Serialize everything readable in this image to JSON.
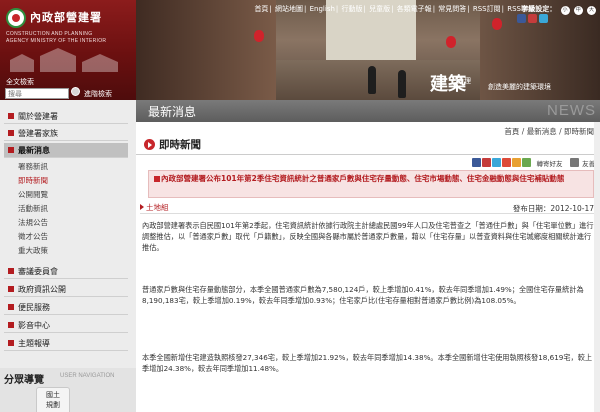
{
  "header": {
    "logo_title": "內政部營建署",
    "logo_sub1": "CONSTRUCTION AND PLANNING",
    "logo_sub2": "AGENCY MINISTRY OF THE INTERIOR",
    "search_label": "全文檢索",
    "search_placeholder": "搜尋",
    "advanced_search": "進階檢索",
    "topnav": [
      "首頁",
      "網站地圖",
      "English",
      "行動版",
      "兒童版",
      "各類電子報",
      "常見問答",
      "RSS訂閱",
      "RSS聯播"
    ],
    "font_size": {
      "label": "字級設定：",
      "small": "小",
      "medium": "中",
      "large": "大"
    },
    "brand": "建築",
    "brand_small": "管理",
    "slogan": "創造美麗的建築環境"
  },
  "title_bar": {
    "section_title": "最新消息",
    "deco": "NEWS"
  },
  "sidebar": {
    "items": [
      {
        "label": "關於營建署"
      },
      {
        "label": "營建署家族"
      },
      {
        "label": "最新消息"
      },
      {
        "label": "審議委員會"
      },
      {
        "label": "政府資訊公開"
      },
      {
        "label": "便民服務"
      },
      {
        "label": "影音中心"
      },
      {
        "label": "主題報導"
      }
    ],
    "sub_items": [
      "署務新訊",
      "即時新聞",
      "公開閱覽",
      "活動新訊",
      "法規公告",
      "徵才公告",
      "重大政策"
    ],
    "share_zone": "分眾導覽",
    "user_nav": "USER NAVIGATION",
    "home_button": "國土\n規劃"
  },
  "content": {
    "page_heading": "即時新聞",
    "breadcrumb": [
      "首頁",
      "最新消息",
      "即時新聞"
    ],
    "tools": {
      "email_label": "轉寄好友",
      "print_label": "友善列印"
    },
    "news_title": "內政部營建署公布101年第2季住宅資訊統計之普通家戶數與住宅存量動態、住宅市場動態、住宅金融動態與住宅補貼動態",
    "department": "土地組",
    "publish_label": "發布日期：",
    "publish_date": "2012-10-17",
    "paragraphs": [
      "內政部營建署表示自民國101年第2季起，住宅資訊統計依據行政院主計總處民國99年人口及住宅普查之「普通住戶數」與「住宅單位數」進行調整推估，以「普通家戶數」取代「戶籍數」，反映全國與各縣市屬於普通家戶數量，藉以「住宅存量」以普查資料與住宅城鄉度相關統計進行推估。",
      "普通家戶數與住宅存量動態部分，本季全國普通家戶數為7,580,124戶，較上季增加0.41%，較去年同季增加1.49%；全國住宅存量統計為8,190,183宅，較上季增加0.19%，較去年同季增加0.93%；住宅家戶比(住宅存量相對普通家戶數比例)為108.05%。",
      "本季全國新增住宅建造執照核發27,346宅，較上季增加21.92%，較去年同季增加14.38%。本季全國新增住宅使用執照核發18,619宅，較上季增加24.38%，較去年同季增加11.48%。"
    ]
  },
  "colors": {
    "brand_red": "#b31c20",
    "title_bar": "#6b6b6b",
    "news_box_bg": "#f7e3e3"
  }
}
